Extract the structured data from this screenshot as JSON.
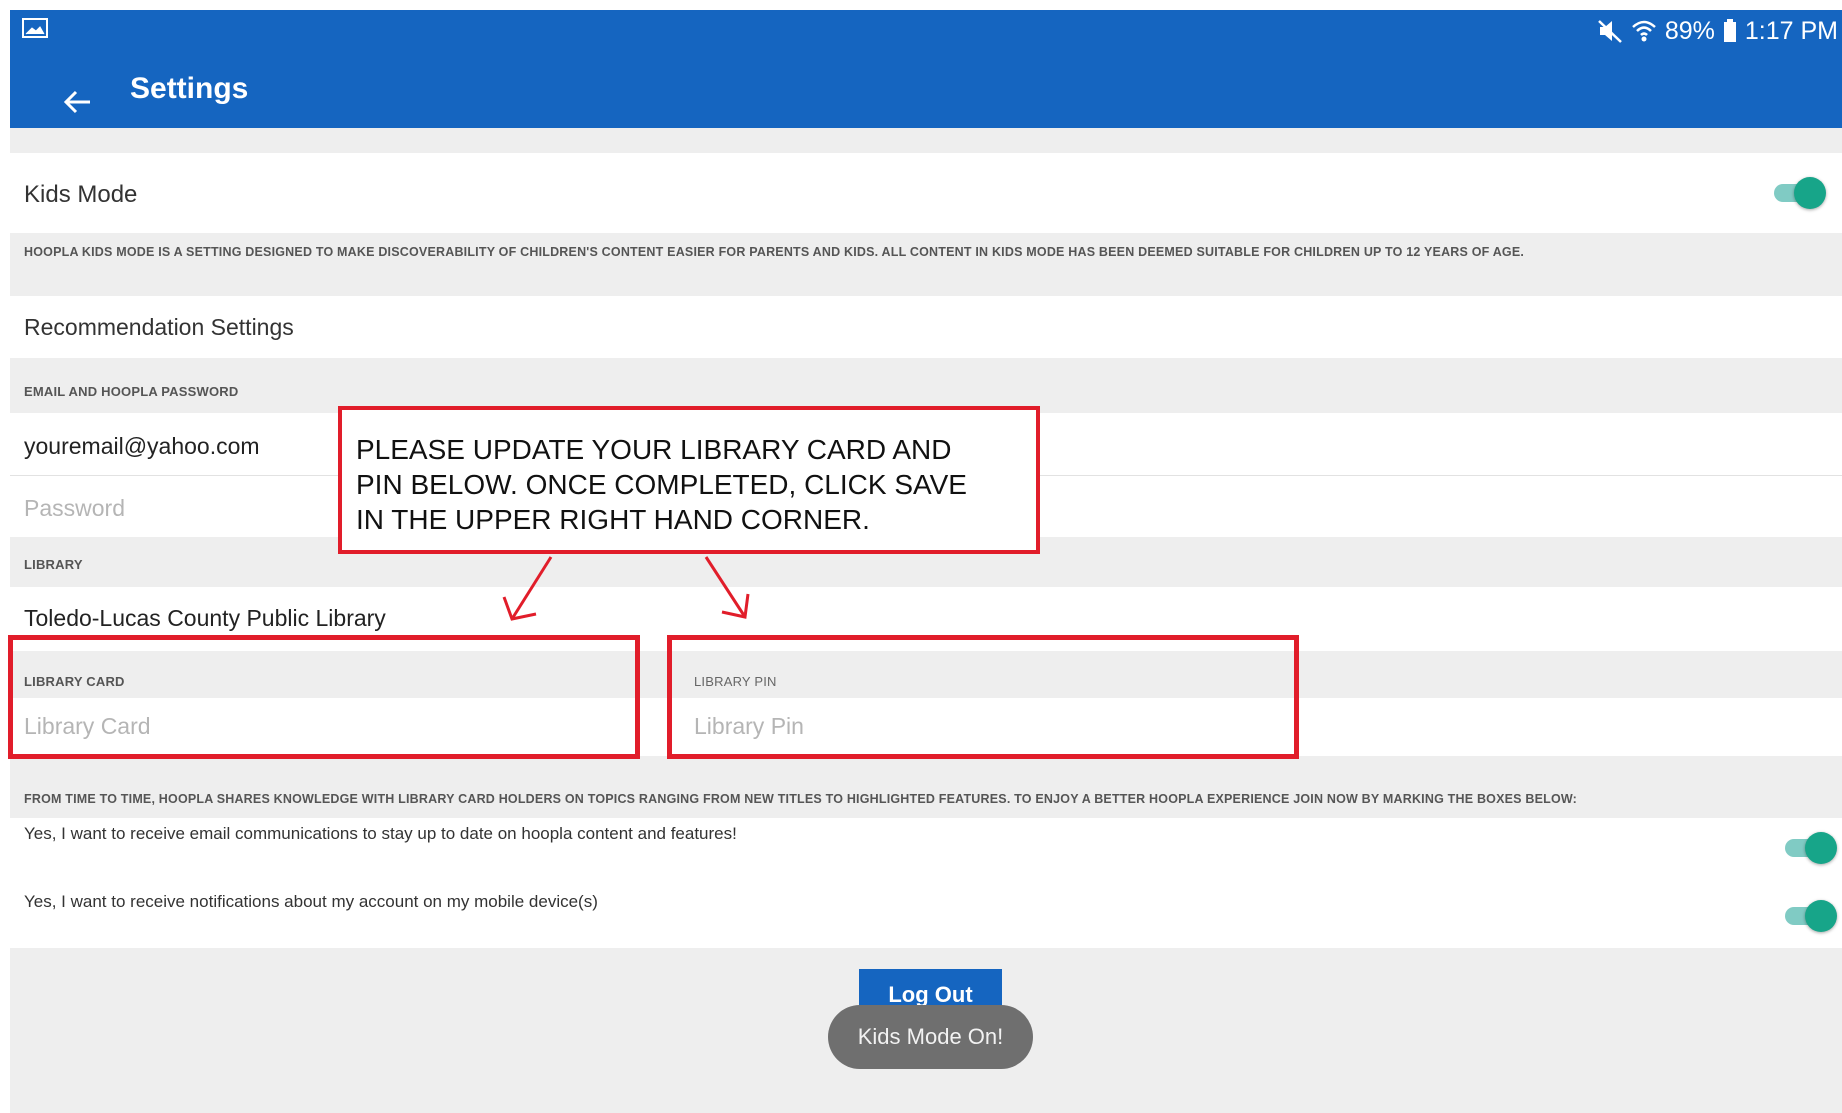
{
  "status_bar": {
    "battery": "89%",
    "time": "1:17 PM"
  },
  "header": {
    "title": "Settings"
  },
  "kids_mode": {
    "label": "Kids Mode",
    "enabled": true,
    "description": "HOOPLA KIDS MODE IS A SETTING DESIGNED TO MAKE DISCOVERABILITY OF CHILDREN'S CONTENT EASIER FOR PARENTS AND KIDS. ALL CONTENT IN KIDS MODE HAS BEEN DEEMED SUITABLE FOR CHILDREN UP TO 12 YEARS OF AGE."
  },
  "recommendation": {
    "label": "Recommendation Settings"
  },
  "account": {
    "caption": "EMAIL AND HOOPLA PASSWORD",
    "email": "youremail@yahoo.com",
    "password_placeholder": "Password"
  },
  "library": {
    "caption": "LIBRARY",
    "name": "Toledo-Lucas County Public Library"
  },
  "library_card": {
    "caption": "LIBRARY CARD",
    "placeholder": "Library Card"
  },
  "library_pin": {
    "caption": "LIBRARY PIN",
    "placeholder": "Library Pin"
  },
  "communications": {
    "caption": "FROM TIME TO TIME, HOOPLA SHARES KNOWLEDGE WITH LIBRARY CARD HOLDERS ON TOPICS RANGING FROM NEW TITLES TO HIGHLIGHTED FEATURES. TO ENJOY A BETTER HOOPLA EXPERIENCE JOIN NOW BY MARKING THE BOXES BELOW:",
    "email_optin": "Yes, I want to receive email communications to stay up to date on hoopla content and features!",
    "email_optin_enabled": true,
    "notify_optin": "Yes, I want to receive notifications about my account on my mobile device(s)",
    "notify_optin_enabled": true
  },
  "logout_label": "Log Out",
  "toast": "Kids Mode On!",
  "annotation": {
    "lines": [
      "PLEASE UPDATE YOUR LIBRARY CARD AND",
      "PIN BELOW.  ONCE COMPLETED, CLICK SAVE",
      "IN THE UPPER RIGHT HAND CORNER."
    ],
    "color": "#e11d2a"
  },
  "colors": {
    "app_bar": "#1565c0",
    "toggle_on": "#17a589",
    "page_background": "#eeeeee"
  },
  "icons": {
    "status_left": "image-icon",
    "mute": "mute-icon",
    "wifi": "wifi-icon",
    "battery": "battery-icon",
    "back": "back-arrow-icon"
  }
}
